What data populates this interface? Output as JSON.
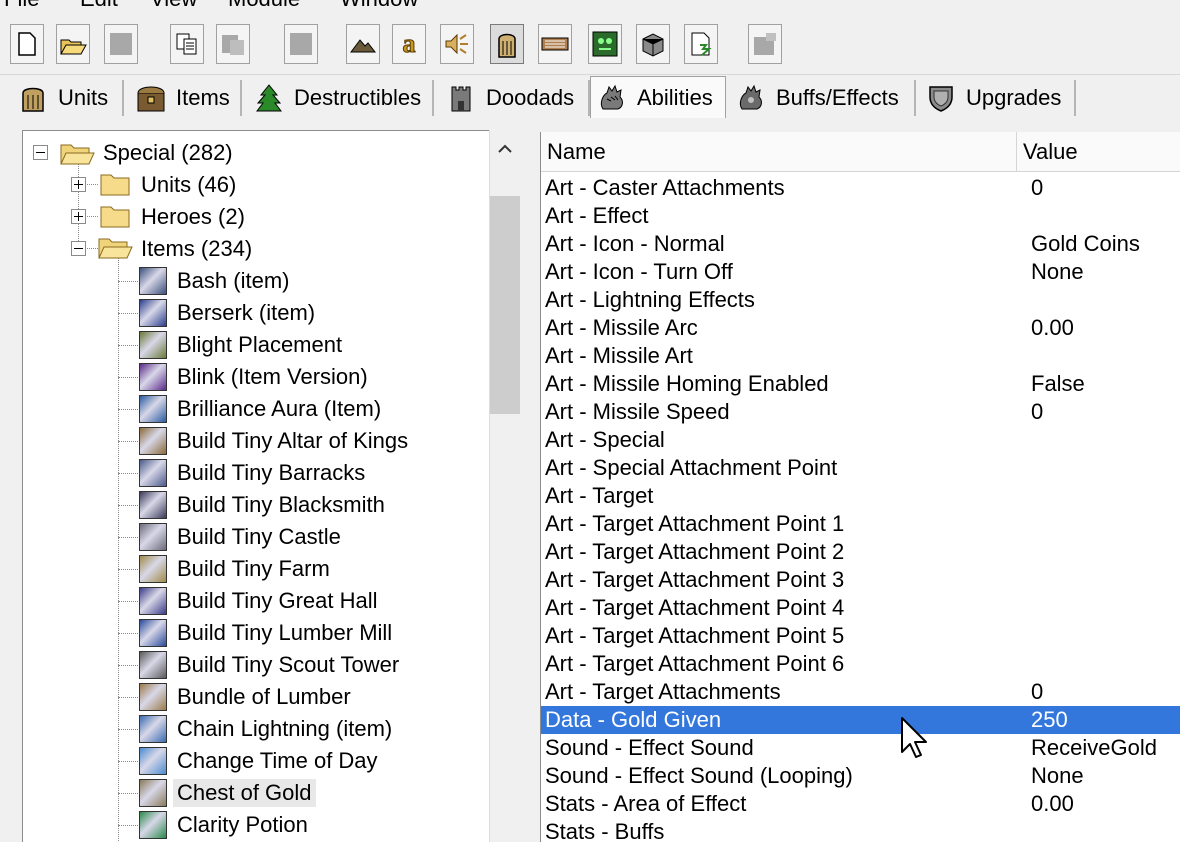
{
  "menu": [
    "File",
    "Edit",
    "View",
    "Module",
    "Window"
  ],
  "toolbar": {
    "buttons": [
      {
        "name": "new-icon"
      },
      {
        "name": "open-icon"
      },
      {
        "name": "save-icon"
      },
      {
        "name": "copy-icon"
      },
      {
        "name": "paste-icon"
      },
      {
        "name": "blank-icon"
      },
      {
        "name": "terrain-editor-icon"
      },
      {
        "name": "trigger-editor-icon"
      },
      {
        "name": "sound-editor-icon"
      },
      {
        "name": "object-editor-icon",
        "pressed": true
      },
      {
        "name": "campaign-editor-icon"
      },
      {
        "name": "ai-editor-icon"
      },
      {
        "name": "import-manager-icon"
      },
      {
        "name": "test-map-icon"
      },
      {
        "name": "disabled-icon"
      }
    ]
  },
  "tabs": [
    {
      "label": "Units",
      "icon": "units-tab-icon"
    },
    {
      "label": "Items",
      "icon": "items-tab-icon"
    },
    {
      "label": "Destructibles",
      "icon": "destructibles-tab-icon"
    },
    {
      "label": "Doodads",
      "icon": "doodads-tab-icon"
    },
    {
      "label": "Abilities",
      "icon": "abilities-tab-icon",
      "active": true
    },
    {
      "label": "Buffs/Effects",
      "icon": "buffs-tab-icon"
    },
    {
      "label": "Upgrades",
      "icon": "upgrades-tab-icon"
    }
  ],
  "tree": {
    "root": {
      "label": "Special (282)",
      "expanded": true
    },
    "folders": [
      {
        "label": "Units (46)",
        "expanded": false
      },
      {
        "label": "Heroes (2)",
        "expanded": false
      },
      {
        "label": "Items (234)",
        "expanded": true
      }
    ],
    "items": [
      {
        "label": "Bash (item)",
        "color": "#3a4f7a"
      },
      {
        "label": "Berserk (item)",
        "color": "#2a3d8c"
      },
      {
        "label": "Blight Placement",
        "color": "#6a7a3a"
      },
      {
        "label": "Blink (Item Version)",
        "color": "#5a2a8a"
      },
      {
        "label": "Brilliance Aura (Item)",
        "color": "#2a5aa0"
      },
      {
        "label": "Build Tiny Altar of Kings",
        "color": "#8a6a3a"
      },
      {
        "label": "Build Tiny Barracks",
        "color": "#4a5a8a"
      },
      {
        "label": "Build Tiny Blacksmith",
        "color": "#3a3a5a"
      },
      {
        "label": "Build Tiny Castle",
        "color": "#6a6a7a"
      },
      {
        "label": "Build Tiny Farm",
        "color": "#a08a4a"
      },
      {
        "label": "Build Tiny Great Hall",
        "color": "#3a3a8a"
      },
      {
        "label": "Build Tiny Lumber Mill",
        "color": "#2a4a9a"
      },
      {
        "label": "Build Tiny Scout Tower",
        "color": "#5a5a5a"
      },
      {
        "label": "Bundle of Lumber",
        "color": "#9a7a4a"
      },
      {
        "label": "Chain Lightning (item)",
        "color": "#3a6ab0"
      },
      {
        "label": "Change Time of Day",
        "color": "#4a8ad0"
      },
      {
        "label": "Chest of Gold",
        "color": "#8a7a5a",
        "selected": true
      },
      {
        "label": "Clarity Potion",
        "color": "#2a8a4a"
      }
    ]
  },
  "table": {
    "col_name": "Name",
    "col_value": "Value",
    "rows": [
      {
        "name": "Art - Caster Attachments",
        "value": "0"
      },
      {
        "name": "Art - Effect",
        "value": ""
      },
      {
        "name": "Art - Icon - Normal",
        "value": "Gold Coins"
      },
      {
        "name": "Art - Icon - Turn Off",
        "value": "None"
      },
      {
        "name": "Art - Lightning Effects",
        "value": ""
      },
      {
        "name": "Art - Missile Arc",
        "value": "0.00"
      },
      {
        "name": "Art - Missile Art",
        "value": ""
      },
      {
        "name": "Art - Missile Homing Enabled",
        "value": "False"
      },
      {
        "name": "Art - Missile Speed",
        "value": "0"
      },
      {
        "name": "Art - Special",
        "value": ""
      },
      {
        "name": "Art - Special Attachment Point",
        "value": ""
      },
      {
        "name": "Art - Target",
        "value": ""
      },
      {
        "name": "Art - Target Attachment Point 1",
        "value": ""
      },
      {
        "name": "Art - Target Attachment Point 2",
        "value": ""
      },
      {
        "name": "Art - Target Attachment Point 3",
        "value": ""
      },
      {
        "name": "Art - Target Attachment Point 4",
        "value": ""
      },
      {
        "name": "Art - Target Attachment Point 5",
        "value": ""
      },
      {
        "name": "Art - Target Attachment Point 6",
        "value": ""
      },
      {
        "name": "Art - Target Attachments",
        "value": "0"
      },
      {
        "name": "Data - Gold Given",
        "value": "250",
        "selected": true
      },
      {
        "name": "Sound - Effect Sound",
        "value": "ReceiveGold"
      },
      {
        "name": "Sound - Effect Sound (Looping)",
        "value": "None"
      },
      {
        "name": "Stats - Area of Effect",
        "value": "0.00"
      },
      {
        "name": "Stats - Buffs",
        "value": ""
      }
    ]
  }
}
